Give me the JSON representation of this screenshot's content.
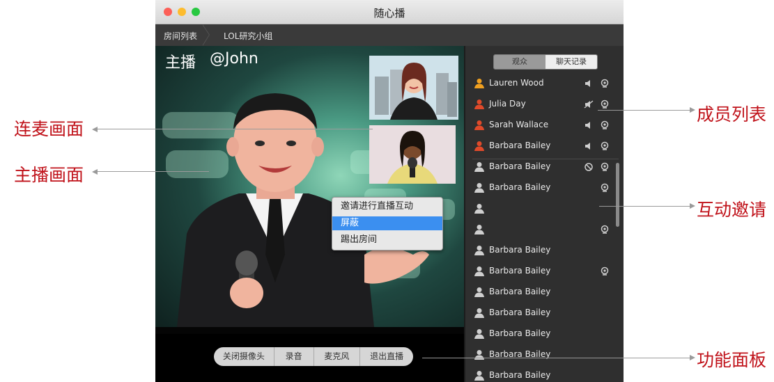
{
  "window": {
    "title": "随心播"
  },
  "breadcrumb": {
    "items": [
      "房间列表",
      "LOL研究小组"
    ]
  },
  "video": {
    "host_label": "主播",
    "host_name": "@John"
  },
  "controls": {
    "buttons": [
      "关闭摄像头",
      "录音",
      "麦克风",
      "退出直播"
    ]
  },
  "panel": {
    "tabs": [
      "观众",
      "聊天记录"
    ],
    "active_tab": 0,
    "members": [
      {
        "name": "Lauren Wood",
        "person_color": "#f0a020",
        "icon1": "speaker-icon",
        "icon2": "camera-icon"
      },
      {
        "name": "Julia Day",
        "person_color": "#e04a2a",
        "icon1": "speaker-muted-icon",
        "icon2": "camera-icon"
      },
      {
        "name": "Sarah Wallace",
        "person_color": "#e04a2a",
        "icon1": "speaker-icon",
        "icon2": "camera-icon"
      },
      {
        "name": "Barbara Bailey",
        "person_color": "#e04a2a",
        "icon1": "speaker-icon",
        "icon2": "camera-icon"
      },
      {
        "name": "Barbara Bailey",
        "person_color": "#cfcfcf",
        "icon1": "ban-icon",
        "icon2": "camera-icon"
      },
      {
        "name": "Barbara Bailey",
        "person_color": "#cfcfcf",
        "icon1": "",
        "icon2": "camera-icon"
      },
      {
        "name": "",
        "person_color": "#cfcfcf",
        "icon1": "",
        "icon2": ""
      },
      {
        "name": "",
        "person_color": "#cfcfcf",
        "icon1": "",
        "icon2": "camera-icon"
      },
      {
        "name": "Barbara Bailey",
        "person_color": "#cfcfcf",
        "icon1": "",
        "icon2": ""
      },
      {
        "name": "Barbara Bailey",
        "person_color": "#cfcfcf",
        "icon1": "",
        "icon2": "camera-icon"
      },
      {
        "name": "Barbara Bailey",
        "person_color": "#cfcfcf",
        "icon1": "",
        "icon2": ""
      },
      {
        "name": "Barbara Bailey",
        "person_color": "#cfcfcf",
        "icon1": "",
        "icon2": ""
      },
      {
        "name": "Barbara Bailey",
        "person_color": "#cfcfcf",
        "icon1": "",
        "icon2": ""
      },
      {
        "name": "Barbara Bailey",
        "person_color": "#cfcfcf",
        "icon1": "",
        "icon2": ""
      },
      {
        "name": "Barbara Bailey",
        "person_color": "#cfcfcf",
        "icon1": "",
        "icon2": ""
      }
    ]
  },
  "context_menu": {
    "items": [
      "邀请进行直播互动",
      "屏蔽",
      "踢出房间"
    ],
    "highlighted": 1
  },
  "annotations": {
    "lianmai": "连麦画面",
    "zhubo": "主播画面",
    "members": "成员列表",
    "invite": "互动邀请",
    "panel": "功能面板"
  },
  "colors": {
    "annotation": "#c0121a",
    "menu_highlight": "#3b8ff0"
  }
}
